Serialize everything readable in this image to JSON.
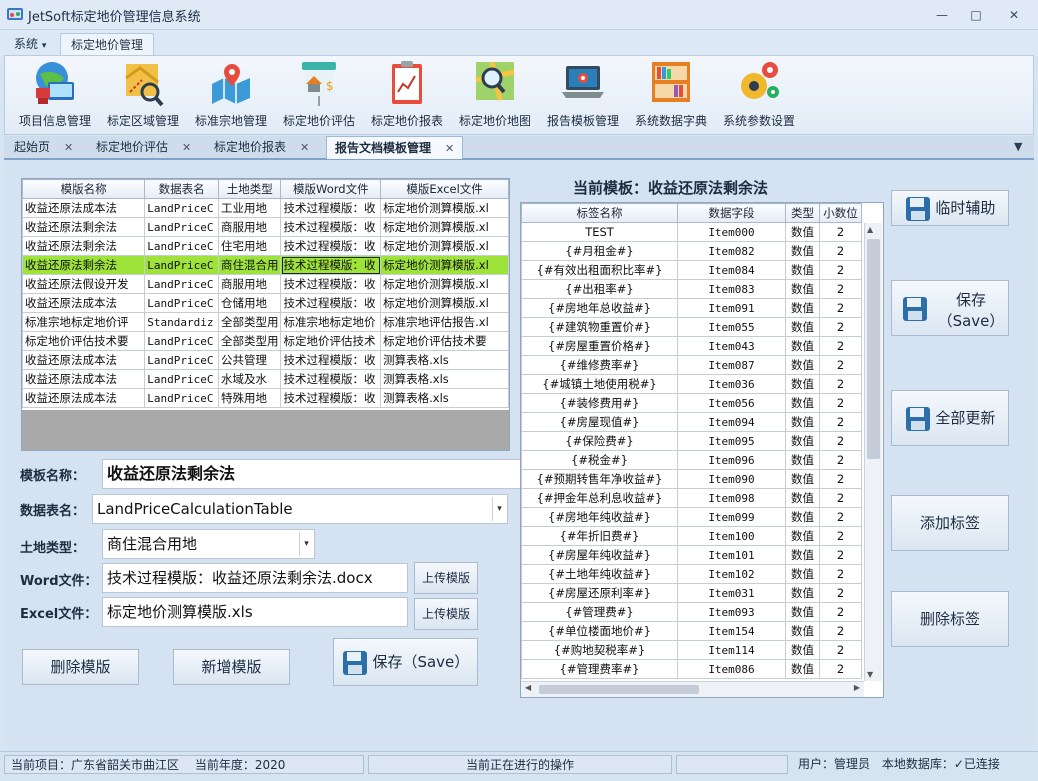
{
  "window": {
    "title": "JetSoft标定地价管理信息系统"
  },
  "ribbon_tabs": [
    {
      "label": "系统",
      "active": false
    },
    {
      "label": "标定地价管理",
      "active": true
    }
  ],
  "ribbon_buttons": [
    {
      "label": "项目信息管理",
      "icon": "globe-computer-icon"
    },
    {
      "label": "标定区域管理",
      "icon": "map-magnifier-icon"
    },
    {
      "label": "标准宗地管理",
      "icon": "map-pin-icon"
    },
    {
      "label": "标定地价评估",
      "icon": "house-dollar-icon"
    },
    {
      "label": "标定地价报表",
      "icon": "report-chart-icon"
    },
    {
      "label": "标定地价地图",
      "icon": "map-search-icon"
    },
    {
      "label": "报告模板管理",
      "icon": "laptop-gear-icon"
    },
    {
      "label": "系统数据字典",
      "icon": "bookshelf-icon"
    },
    {
      "label": "系统参数设置",
      "icon": "gears-icon"
    }
  ],
  "doc_tabs": [
    {
      "label": "起始页",
      "active": false
    },
    {
      "label": "标定地价评估",
      "active": false
    },
    {
      "label": "标定地价报表",
      "active": false
    },
    {
      "label": "报告文档模板管理",
      "active": true
    }
  ],
  "template_grid": {
    "columns": [
      "模版名称",
      "数据表名",
      "土地类型",
      "模版Word文件",
      "模版Excel文件"
    ],
    "rows": [
      [
        "收益还原法成本法",
        "LandPriceC",
        "工业用地",
        "技术过程模版：收",
        "标定地价测算模版.xl"
      ],
      [
        "收益还原法剩余法",
        "LandPriceC",
        "商服用地",
        "技术过程模版：收",
        "标定地价测算模版.xl"
      ],
      [
        "收益还原法剩余法",
        "LandPriceC",
        "住宅用地",
        "技术过程模版：收",
        "标定地价测算模版.xl"
      ],
      [
        "收益还原法剩余法",
        "LandPriceC",
        "商住混合用",
        "技术过程模版：收",
        "标定地价测算模版.xl"
      ],
      [
        "收益还原法假设开发",
        "LandPriceC",
        "商服用地",
        "技术过程模版：收",
        "标定地价测算模版.xl"
      ],
      [
        "收益还原法成本法",
        "LandPriceC",
        "仓储用地",
        "技术过程模版：收",
        "标定地价测算模版.xl"
      ],
      [
        "标准宗地标定地价评",
        "Standardiz",
        "全部类型用",
        "标准宗地标定地价",
        "标准宗地评估报告.xl"
      ],
      [
        "标定地价评估技术要",
        "LandPriceC",
        "全部类型用",
        "标定地价评估技术",
        "标定地价评估技术要"
      ],
      [
        "收益还原法成本法",
        "LandPriceC",
        "公共管理",
        "技术过程模版：收",
        "测算表格.xls"
      ],
      [
        "收益还原法成本法",
        "LandPriceC",
        "水域及水",
        "技术过程模版：收",
        "测算表格.xls"
      ],
      [
        "收益还原法成本法",
        "LandPriceC",
        "特殊用地",
        "技术过程模版：收",
        "测算表格.xls"
      ]
    ],
    "selected_row": 3
  },
  "form": {
    "template_name_label": "模板名称：",
    "template_name_value": "收益还原法剩余法",
    "table_name_label": "数据表名：",
    "table_name_value": "LandPriceCalculationTable",
    "land_type_label": "土地类型：",
    "land_type_value": "商住混合用地",
    "word_label": "Word文件：",
    "word_value": "技术过程模版：收益还原法剩余法.docx",
    "excel_label": "Excel文件：",
    "excel_value": "标定地价测算模版.xls",
    "upload_label": "上传模版",
    "delete_label": "删除模版",
    "add_label": "新增模版",
    "save_label": "保存（Save）"
  },
  "current_template": {
    "title": "当前模板：收益还原法剩余法",
    "columns": [
      "标签名称",
      "数据字段",
      "类型",
      "小数位"
    ],
    "rows": [
      [
        "TEST",
        "Item000",
        "数值",
        "2"
      ],
      [
        "{#月租金#}",
        "Item082",
        "数值",
        "2"
      ],
      [
        "{#有效出租面积比率#}",
        "Item084",
        "数值",
        "2"
      ],
      [
        "{#出租率#}",
        "Item083",
        "数值",
        "2"
      ],
      [
        "{#房地年总收益#}",
        "Item091",
        "数值",
        "2"
      ],
      [
        "{#建筑物重置价#}",
        "Item055",
        "数值",
        "2"
      ],
      [
        "{#房屋重置价格#}",
        "Item043",
        "数值",
        "2"
      ],
      [
        "{#维修费率#}",
        "Item087",
        "数值",
        "2"
      ],
      [
        "{#城镇土地使用税#}",
        "Item036",
        "数值",
        "2"
      ],
      [
        "{#装修费用#}",
        "Item056",
        "数值",
        "2"
      ],
      [
        "{#房屋现值#}",
        "Item094",
        "数值",
        "2"
      ],
      [
        "{#保险费#}",
        "Item095",
        "数值",
        "2"
      ],
      [
        "{#税金#}",
        "Item096",
        "数值",
        "2"
      ],
      [
        "{#预期转售年净收益#}",
        "Item090",
        "数值",
        "2"
      ],
      [
        "{#押金年总利息收益#}",
        "Item098",
        "数值",
        "2"
      ],
      [
        "{#房地年纯收益#}",
        "Item099",
        "数值",
        "2"
      ],
      [
        "{#年折旧费#}",
        "Item100",
        "数值",
        "2"
      ],
      [
        "{#房屋年纯收益#}",
        "Item101",
        "数值",
        "2"
      ],
      [
        "{#土地年纯收益#}",
        "Item102",
        "数值",
        "2"
      ],
      [
        "{#房屋还原利率#}",
        "Item031",
        "数值",
        "2"
      ],
      [
        "{#管理费#}",
        "Item093",
        "数值",
        "2"
      ],
      [
        "{#单位楼面地价#}",
        "Item154",
        "数值",
        "2"
      ],
      [
        "{#购地契税率#}",
        "Item114",
        "数值",
        "2"
      ],
      [
        "{#管理费率#}",
        "Item086",
        "数值",
        "2"
      ]
    ]
  },
  "side_buttons": {
    "temp_assist": "临时辅助",
    "save_line1": "保存",
    "save_line2": "（Save）",
    "update_all": "全部更新",
    "add_tag": "添加标签",
    "delete_tag": "删除标签"
  },
  "status": {
    "project": "当前项目：广东省韶关市曲江区",
    "year": "当前年度：2020",
    "operation": "当前正在进行的操作",
    "user": "用户：管理员",
    "db": "本地数据库：✓已连接"
  },
  "colors": {
    "selected_row": "#9ee33a",
    "panel_bg": "#d4e2f1",
    "ribbon_bg": "#e8f0f9"
  }
}
